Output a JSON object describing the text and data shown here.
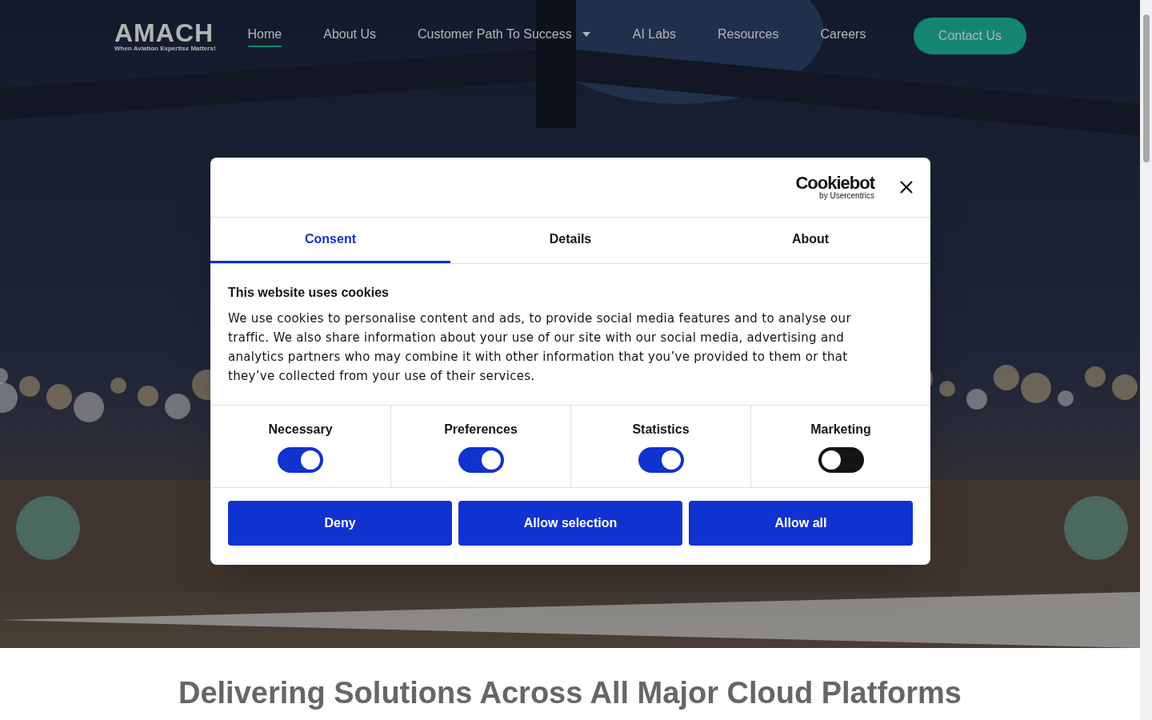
{
  "logo": {
    "wordmark": "AMACH",
    "tagline": "When Aviation Expertise Matters!"
  },
  "nav": {
    "items": [
      {
        "label": "Home",
        "selected": true,
        "dropdown": false
      },
      {
        "label": "About Us",
        "selected": false,
        "dropdown": false
      },
      {
        "label": "Customer Path To Success",
        "selected": false,
        "dropdown": true
      },
      {
        "label": "AI Labs",
        "selected": false,
        "dropdown": false
      },
      {
        "label": "Resources",
        "selected": false,
        "dropdown": false
      },
      {
        "label": "Careers",
        "selected": false,
        "dropdown": false
      }
    ],
    "cta": "Contact Us"
  },
  "cookie_dialog": {
    "brand": "Cookiebot",
    "brand_sub": "by Usercentrics",
    "tabs": [
      {
        "label": "Consent",
        "selected": true
      },
      {
        "label": "Details",
        "selected": false
      },
      {
        "label": "About",
        "selected": false
      }
    ],
    "heading": "This website uses cookies",
    "body": "We use cookies to personalise content and ads, to provide social media features and to analyse our traffic. We also share information about your use of our site with our social media, advertising and analytics partners who may combine it with other information that you’ve provided to them or that they’ve collected from your use of their services.",
    "toggles": [
      {
        "label": "Necessary",
        "on": true
      },
      {
        "label": "Preferences",
        "on": true
      },
      {
        "label": "Statistics",
        "on": true
      },
      {
        "label": "Marketing",
        "on": false
      }
    ],
    "buttons": [
      "Deny",
      "Allow selection",
      "Allow all"
    ]
  },
  "section_heading": "Delivering Solutions Across All Major Cloud Platforms"
}
